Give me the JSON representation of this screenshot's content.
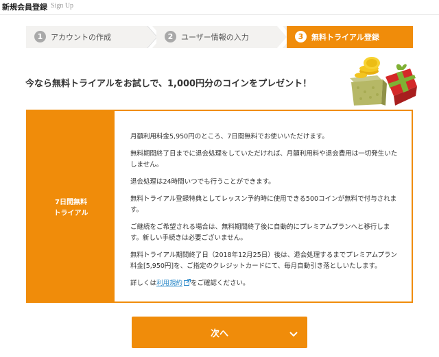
{
  "header": {
    "title": "新規会員登録",
    "subtitle": "Sign Up"
  },
  "steps": [
    {
      "num": "1",
      "label": "アカウントの作成",
      "active": false
    },
    {
      "num": "2",
      "label": "ユーザー情報の入力",
      "active": false
    },
    {
      "num": "3",
      "label": "無料トライアル登録",
      "active": true
    }
  ],
  "headline": "今なら無料トライアルをお試しで、1,000円分のコインをプレゼント！",
  "panel": {
    "side_label_line1": "7日間無料",
    "side_label_line2": "トライアル",
    "paragraphs": [
      "月額利用料金5,950円のところ、7日間無料でお使いいただけます。",
      "無料期間終了日までに退会処理をしていただければ、月額利用料や退会費用は一切発生いたしません。",
      "退会処理は24時間いつでも行うことができます。",
      "無料トライアル登録特典としてレッスン予約時に使用できる500コインが無料で付与されます。",
      "ご継続をご希望される場合は、無料期間終了後に自動的にプレミアムプランへと移行します。新しい手続きは必要ございません。",
      "無料トライアル期間終了日（2018年12月25日）後は、退会処理するまでプレミアムプラン料金[5,950円]を、ご指定のクレジットカードにて、毎月自動引き落としいたします。"
    ],
    "detail_prefix": "詳しくは",
    "terms_link": "利用規約",
    "detail_suffix": "をご確認ください。"
  },
  "next_button": {
    "label": "次へ"
  },
  "icons": {
    "external": "external-link-icon",
    "chevron": "chevron-down-icon",
    "gift": "gift-icon"
  },
  "colors": {
    "accent": "#f08c0a",
    "step_inactive": "#f3f2f0",
    "link": "#2a88c8"
  }
}
